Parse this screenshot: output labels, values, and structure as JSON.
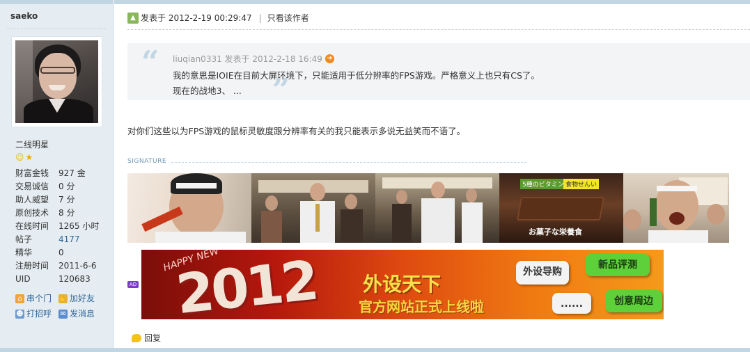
{
  "user": {
    "username": "saeko",
    "rank": "二线明星",
    "rank_icons": [
      "smiley-icon",
      "star-icon"
    ],
    "stats": [
      {
        "key": "财富金钱",
        "value": "927 金"
      },
      {
        "key": "交易诚信",
        "value": "0 分"
      },
      {
        "key": "助人威望",
        "value": "7 分"
      },
      {
        "key": "原创技术",
        "value": "8 分"
      },
      {
        "key": "在线时间",
        "value": "1265 小时"
      },
      {
        "key": "帖子",
        "value": "4177"
      },
      {
        "key": "精华",
        "value": "0"
      },
      {
        "key": "注册时间",
        "value": "2011-6-6"
      },
      {
        "key": "UID",
        "value": "120683"
      }
    ],
    "actions": {
      "visit": "串个门",
      "add_friend": "加好友",
      "poke": "打招呼",
      "message": "发消息"
    }
  },
  "post": {
    "posted_at": "发表于 2012-2-19 00:29:47",
    "author_only": "只看该作者",
    "quote": {
      "header": "liuqian0331 发表于 2012-2-18 16:49",
      "line1": "我的意思是IOIE在目前大屏环境下，只能适用于低分辨率的FPS游戏。严格意义上也只有CS了。",
      "line2": "现在的战地3、 ..."
    },
    "body": "对你们这些以为FPS游戏的鼠标灵敏度跟分辨率有关的我只能表示多说无益笑而不语了。",
    "signature_label": "SIGNATURE",
    "strip": {
      "tag1": "5種のビタミン",
      "tag2": "食物せんい",
      "caption": "お菓子な栄養食"
    },
    "ad_badge": "AD",
    "banner": {
      "happy": "HAPPY NEW",
      "year": "2012",
      "title1": "外设天下",
      "title2": "官方网站正式上线啦",
      "bubble1": "外设导购",
      "bubble2": "新品评测",
      "bubble3": "......",
      "bubble4": "创意周边"
    },
    "reply": "回复"
  }
}
